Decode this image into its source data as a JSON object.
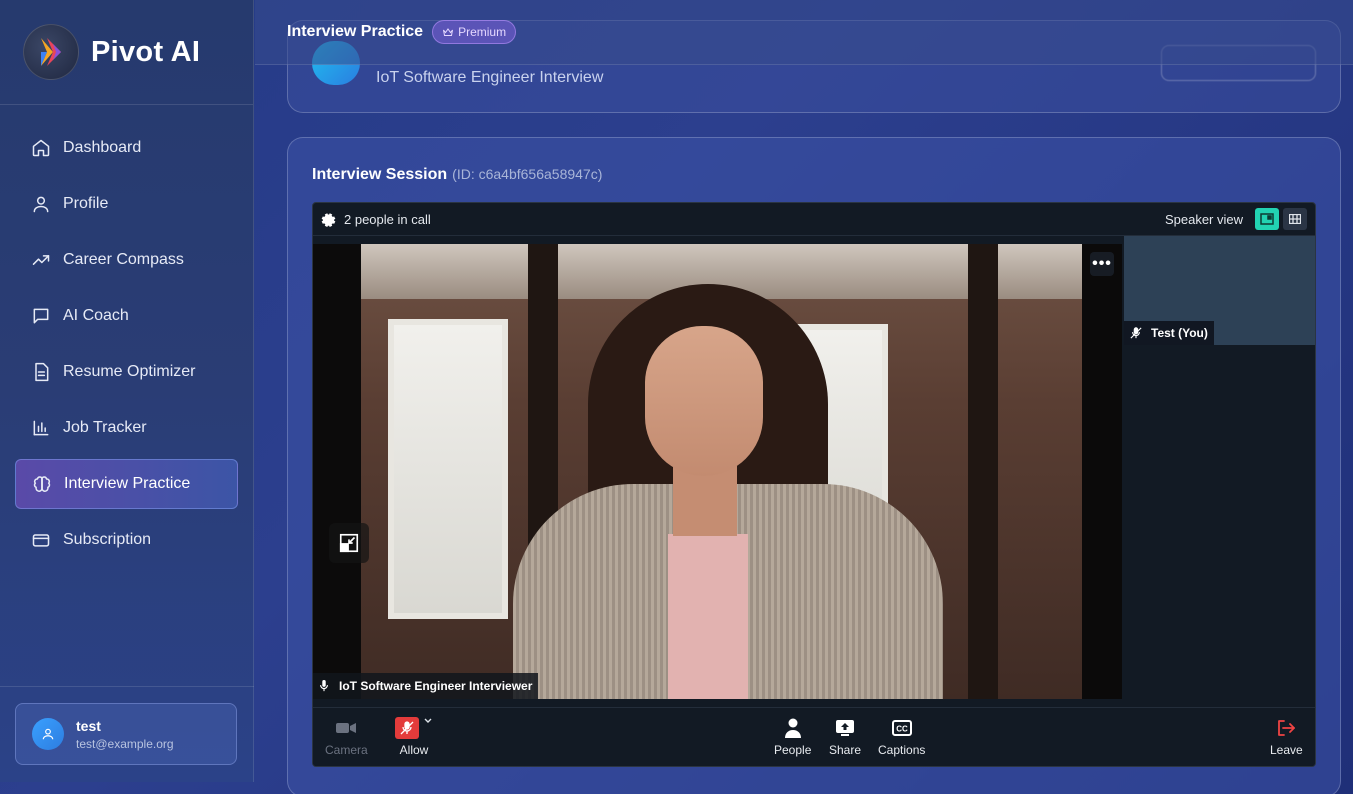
{
  "brand": {
    "name": "Pivot AI"
  },
  "sidebar": {
    "items": [
      {
        "label": "Dashboard",
        "icon": "home-icon"
      },
      {
        "label": "Profile",
        "icon": "user-icon"
      },
      {
        "label": "Career Compass",
        "icon": "trending-up-icon"
      },
      {
        "label": "AI Coach",
        "icon": "message-square-icon"
      },
      {
        "label": "Resume Optimizer",
        "icon": "file-text-icon"
      },
      {
        "label": "Job Tracker",
        "icon": "bar-chart-icon"
      },
      {
        "label": "Interview Practice",
        "icon": "brain-icon",
        "active": true
      },
      {
        "label": "Subscription",
        "icon": "credit-card-icon"
      }
    ]
  },
  "user": {
    "name": "test",
    "email": "test@example.org"
  },
  "header": {
    "title": "Interview Practice",
    "badge": "Premium"
  },
  "interview": {
    "subtitle": "IoT Software Engineer Interview"
  },
  "session": {
    "title": "Interview Session",
    "id_text": "(ID: c6a4bf656a58947c)"
  },
  "call": {
    "people_count": "2 people in call",
    "view_mode": "Speaker view",
    "main_participant": "IoT Software Engineer Interviewer",
    "self_participant": "Test (You)",
    "controls": {
      "camera": "Camera",
      "allow": "Allow",
      "people": "People",
      "share": "Share",
      "captions": "Captions",
      "leave": "Leave"
    }
  },
  "colors": {
    "accent": "#22d3b2",
    "leave": "#ef4444",
    "mic_off": "#e33b3b"
  }
}
